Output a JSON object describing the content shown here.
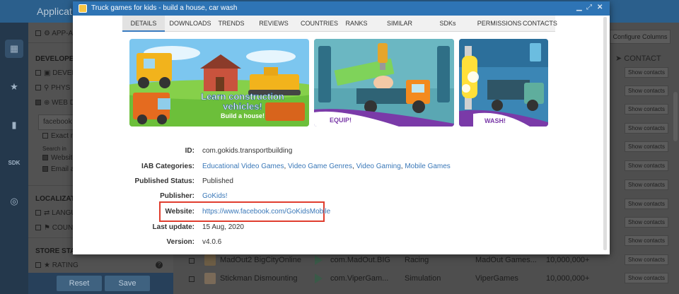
{
  "background": {
    "app_title": "Applicat",
    "sidebar": {
      "row_app": "APP-A",
      "developer_heading": "DEVELOPER",
      "row_devel": "DEVEL",
      "row_phys": "PHYS",
      "row_web": "WEB D",
      "search_value": "facebook",
      "exact": "Exact m",
      "search_in": "Search in",
      "website": "Website",
      "email": "Email a",
      "localization_heading": "LOCALIZATIO",
      "row_lang": "LANGU",
      "row_coun": "COUN",
      "store_heading": "STORE STAT",
      "rating": "RATING"
    },
    "footer": {
      "reset": "Reset",
      "save": "Save"
    },
    "configure_columns": "Configure Columns",
    "contact_label": "CONTACT",
    "show_contacts": "Show contacts",
    "rows": [
      {
        "name": "MadOut2 BigCityOnline",
        "package": "com.MadOut.BIG",
        "category": "Racing",
        "developer": "MadOut Games...",
        "installs": "10,000,000+"
      },
      {
        "name": "Stickman Dismounting",
        "package": "com.ViperGam...",
        "category": "Simulation",
        "developer": "ViperGames",
        "installs": "10,000,000+"
      }
    ]
  },
  "modal": {
    "title": "Truck games for kids - build a house, car wash",
    "tabs": [
      "DETAILS",
      "DOWNLOADS",
      "TRENDS",
      "REVIEWS",
      "COUNTRIES",
      "RANKS",
      "SIMILAR",
      "SDKs",
      "PERMISSIONS",
      "CONTACTS"
    ],
    "screenshots": {
      "s1_line1": "Learn construction",
      "s1_line2": "vehicles!",
      "s1_line3": "Build a house!",
      "s2_badge": "EQUIP!",
      "s3_badge": "WASH!"
    },
    "details": {
      "id_label": "ID:",
      "id_value": "com.gokids.transportbuilding",
      "iab_label": "IAB Categories:",
      "iab_values": [
        "Educational Video Games",
        "Video Game Genres",
        "Video Gaming",
        "Mobile Games"
      ],
      "status_label": "Published Status:",
      "status_value": "Published",
      "publisher_label": "Publisher:",
      "publisher_value": "GoKids!",
      "website_label": "Website:",
      "website_value": "https://www.facebook.com/GoKidsMobile",
      "update_label": "Last update:",
      "update_value": "15 Aug, 2020",
      "version_label": "Version:",
      "version_value": "v4.0.6"
    }
  }
}
